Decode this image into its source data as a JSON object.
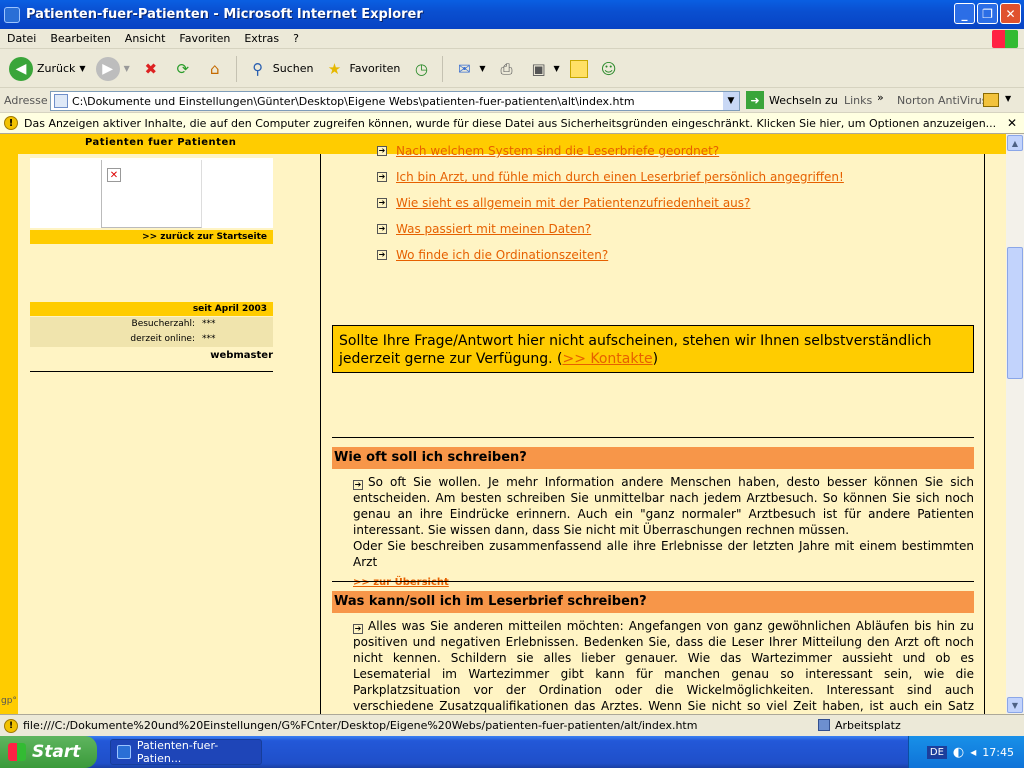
{
  "window": {
    "title": "Patienten-fuer-Patienten - Microsoft Internet Explorer"
  },
  "menu": [
    "Datei",
    "Bearbeiten",
    "Ansicht",
    "Favoriten",
    "Extras",
    "?"
  ],
  "toolbar": {
    "back": "Zurück",
    "search": "Suchen",
    "favorites": "Favoriten"
  },
  "address": {
    "label": "Adresse",
    "value": "C:\\Dokumente und Einstellungen\\Günter\\Desktop\\Eigene Webs\\patienten-fuer-patienten\\alt\\index.htm",
    "go": "Wechseln zu",
    "links": "Links",
    "norton": "Norton AntiVirus"
  },
  "infobar": {
    "text": "Das Anzeigen aktiver Inhalte, die auf den Computer zugreifen können, wurde für diese Datei aus Sicherheitsgründen eingeschränkt. Klicken Sie hier, um Optionen anzuzeigen..."
  },
  "site": {
    "header": "Patienten fuer Patienten",
    "back_link": ">> zurück zur Startseite",
    "since": "seit April 2003",
    "visitors_label": "Besucherzahl:",
    "visitors_value": "***",
    "online_label": "derzeit online:",
    "online_value": "***",
    "webmaster": "webmaster",
    "gp": "gp°"
  },
  "faq_links": [
    "Nach welchem System sind die Leserbriefe geordnet?",
    "Ich bin Arzt, und fühle mich durch einen Leserbrief persönlich angegriffen!",
    "Wie sieht es allgemein mit der Patientenzufriedenheit aus?",
    "Was passiert mit meinen Daten?",
    "Wo finde ich die Ordinationszeiten?"
  ],
  "notice": {
    "text": "Sollte Ihre Frage/Antwort hier nicht aufscheinen, stehen wir Ihnen selbstverständlich jederzeit gerne zur Verfügung. (",
    "link": ">> Kontakte",
    "close": ")"
  },
  "sections": [
    {
      "title": "Wie oft soll ich schreiben?",
      "body": "So oft Sie wollen. Je mehr Information andere Menschen haben, desto besser können Sie sich entscheiden. Am besten schreiben Sie unmittelbar nach jedem Arztbesuch. So können Sie sich noch genau an ihre Eindrücke erinnern. Auch ein \"ganz normaler\" Arztbesuch ist für andere Patienten interessant. Sie wissen dann, dass Sie nicht mit Überraschungen rechnen müssen.",
      "body2": "Oder Sie beschreiben zusammenfassend alle ihre Erlebnisse der letzten Jahre mit einem bestimmten Arzt",
      "back": ">> zur Übersicht"
    },
    {
      "title": "Was kann/soll ich im Leserbrief schreiben?",
      "body": "Alles was Sie anderen mitteilen möchten: Angefangen von ganz gewöhnlichen Abläufen bis hin zu positiven und negativen Erlebnissen. Bedenken Sie, dass die Leser Ihrer Mitteilung den Arzt oft noch nicht kennen. Schildern sie alles lieber genauer. Wie das Wartezimmer aussieht und ob es Lesematerial im Wartezimmer gibt kann für manchen genau so interessant sein, wie die Parkplatzsituation vor der Ordination oder die Wickelmöglichkeiten. Interessant sind auch verschiedene Zusatzqualifikationen das Arztes. Wenn Sie nicht so viel Zeit haben, ist auch ein Satz schon wichtig. Wenn bei einem bestimmten Arzt die Zeit oft knapp ist, können Sie Ihre Erlebnisse auch in Stichworten schildern."
    }
  ],
  "status": {
    "url": "file:///C:/Dokumente%20und%20Einstellungen/G%FCnter/Desktop/Eigene%20Webs/patienten-fuer-patienten/alt/index.htm",
    "zone": "Arbeitsplatz"
  },
  "taskbar": {
    "start": "Start",
    "task": "Patienten-fuer-Patien...",
    "lang": "DE",
    "time": "17:45"
  },
  "colors": {
    "gold": "#ffcc00",
    "cream": "#fff4c4",
    "orange": "#f79649",
    "link": "#e66000"
  }
}
